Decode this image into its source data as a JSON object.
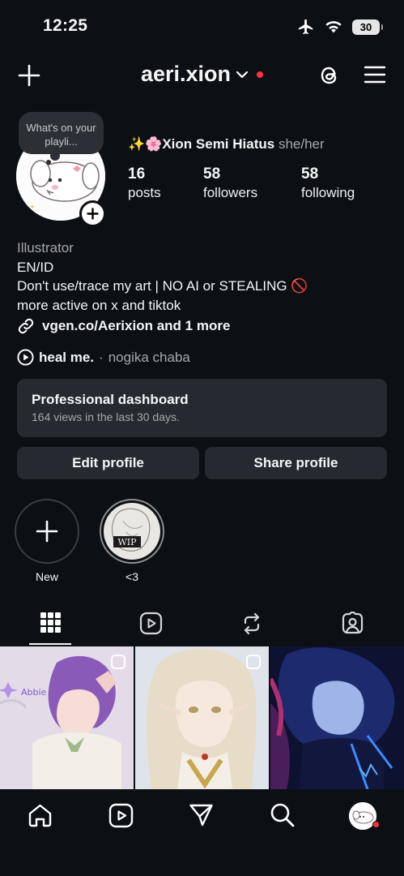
{
  "status_bar": {
    "time": "12:25",
    "battery": "30"
  },
  "header": {
    "username": "aeri.xion"
  },
  "profile": {
    "note": "What's on your playli...",
    "name_emojis": "✨🌸",
    "name": "Xion Semi Hiatus",
    "pronouns": "she/her",
    "stats": [
      {
        "value": "16",
        "label": "posts"
      },
      {
        "value": "58",
        "label": "followers"
      },
      {
        "value": "58",
        "label": "following"
      }
    ],
    "category": "Illustrator",
    "bio_lines": [
      "EN/ID",
      "Don't use/trace my art | NO AI or STEALING 🚫",
      "more active on x and tiktok"
    ],
    "link": "vgen.co/Aerixion and 1 more",
    "music": {
      "song": "heal me.",
      "separator": "·",
      "artist": "nogika chaba"
    }
  },
  "dashboard": {
    "title": "Professional dashboard",
    "subtitle": "164 views in the last 30 days."
  },
  "buttons": {
    "edit": "Edit profile",
    "share": "Share profile"
  },
  "highlights": [
    {
      "label": "New"
    },
    {
      "label": "<3",
      "cover_text": "WIP"
    }
  ],
  "tabs": [
    {
      "icon": "grid-icon",
      "active": true
    },
    {
      "icon": "reels-icon",
      "active": false
    },
    {
      "icon": "reposts-icon",
      "active": false
    },
    {
      "icon": "tagged-icon",
      "active": false
    }
  ],
  "posts": [
    {
      "overlay_text": "Abbie"
    },
    {
      "overlay_text": ""
    },
    {
      "overlay_text": ""
    }
  ],
  "bottom_nav": [
    "home-icon",
    "reels-icon",
    "messages-icon",
    "search-icon",
    "profile-icon"
  ],
  "colors": {
    "background": "#0c0f14",
    "surface": "#26292f",
    "notification": "#ff3040",
    "muted_text": "#a8a8a8"
  }
}
